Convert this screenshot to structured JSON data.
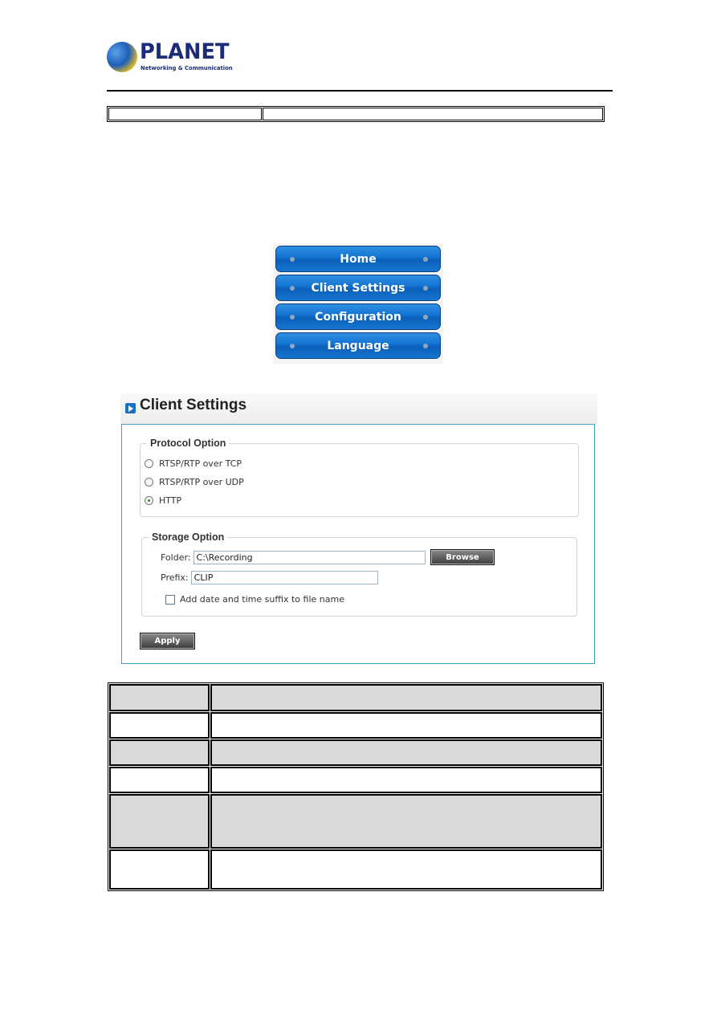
{
  "header": {
    "logo": {
      "name": "PLANET",
      "tagline": "Networking & Communication",
      "icon": "globe-logo-icon"
    },
    "top_table": {
      "cells": [
        "",
        ""
      ]
    }
  },
  "menu": {
    "items": [
      {
        "label": "Home"
      },
      {
        "label": "Client Settings"
      },
      {
        "label": "Configuration"
      },
      {
        "label": "Language"
      }
    ]
  },
  "panel": {
    "title": "Client Settings",
    "icon": "play-arrow-icon",
    "protocol": {
      "legend": "Protocol Option",
      "options": [
        {
          "label": "RTSP/RTP over TCP",
          "selected": false
        },
        {
          "label": "RTSP/RTP over UDP",
          "selected": false
        },
        {
          "label": "HTTP",
          "selected": true
        }
      ]
    },
    "storage": {
      "legend": "Storage Option",
      "folder_label": "Folder:",
      "folder_value": "C:\\Recording",
      "browse_label": "Browse",
      "prefix_label": "Prefix:",
      "prefix_value": "CLIP",
      "suffix_checkbox_label": "Add date and time suffix to file name",
      "suffix_checked": false
    },
    "apply_label": "Apply"
  },
  "desc_table": {
    "rows": [
      {
        "key": "",
        "value": "",
        "shaded": true
      },
      {
        "key": "",
        "value": "",
        "shaded": false
      },
      {
        "key": "",
        "value": "",
        "shaded": true
      },
      {
        "key": "",
        "value": "",
        "shaded": false
      },
      {
        "key": "",
        "value": "",
        "shaded": true
      },
      {
        "key": "",
        "value": "",
        "shaded": false
      }
    ]
  },
  "colors": {
    "brand": "#1c2c78",
    "menu_button": "#1576d4",
    "panel_border": "#3d9cc0",
    "table_shade": "#d9d9d9"
  }
}
